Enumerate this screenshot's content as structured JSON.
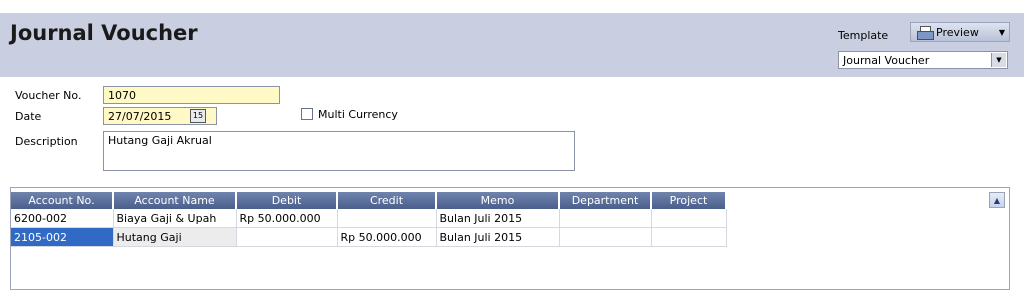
{
  "header": {
    "title": "Journal Voucher",
    "template_label": "Template",
    "preview_label": "Preview",
    "template_value": "Journal Voucher"
  },
  "form": {
    "voucher_label": "Voucher No.",
    "voucher_value": "1070",
    "date_label": "Date",
    "date_value": "27/07/2015",
    "calendar_glyph": "15",
    "multi_currency_label": "Multi Currency",
    "description_label": "Description",
    "description_value": "Hutang Gaji Akrual"
  },
  "grid": {
    "columns": [
      "Account No.",
      "Account Name",
      "Debit",
      "Credit",
      "Memo",
      "Department",
      "Project"
    ],
    "rows": [
      [
        "6200-002",
        "Biaya Gaji & Upah",
        "Rp 50.000.000",
        "",
        "Bulan Juli 2015",
        "",
        ""
      ],
      [
        "2105-002",
        "Hutang Gaji",
        "",
        "Rp 50.000.000",
        "Bulan Juli 2015",
        "",
        ""
      ]
    ]
  },
  "icons": {
    "preview": "printer-icon",
    "dropdown": "chevron-down-icon",
    "calendar": "calendar-icon",
    "scroll": "scroll-up-icon"
  }
}
